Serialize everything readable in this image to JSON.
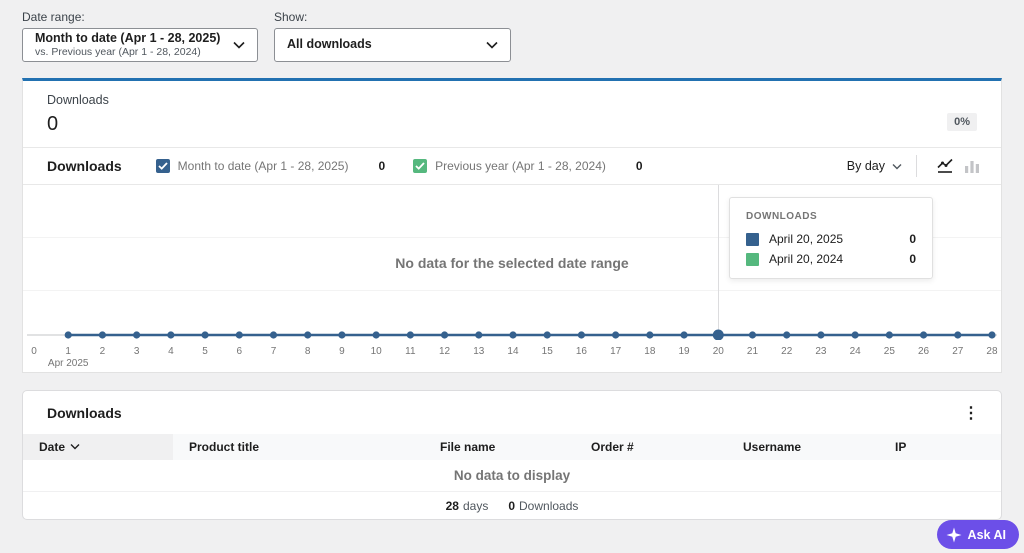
{
  "filters": {
    "date_range": {
      "label": "Date range:",
      "primary": "Month to date (Apr 1 - 28, 2025)",
      "secondary": "vs. Previous year (Apr 1 - 28, 2024)"
    },
    "show": {
      "label": "Show:",
      "value": "All downloads"
    }
  },
  "summary": {
    "label": "Downloads",
    "value": "0",
    "delta": "0%"
  },
  "chart": {
    "title": "Downloads",
    "interval": "By day",
    "empty_message": "No data for the selected date range",
    "month_label": "Apr 2025",
    "legend": [
      {
        "label": "Month to date (Apr 1 - 28, 2025)",
        "value": "0",
        "color": "#35618e",
        "checked": true
      },
      {
        "label": "Previous year (Apr 1 - 28, 2024)",
        "value": "0",
        "color": "#55b87e",
        "checked": true
      }
    ],
    "tooltip": {
      "header": "DOWNLOADS",
      "rows": [
        {
          "label": "April 20, 2025",
          "value": "0",
          "color": "#35618e"
        },
        {
          "label": "April 20, 2024",
          "value": "0",
          "color": "#55b87e"
        }
      ]
    }
  },
  "chart_data": {
    "type": "line",
    "title": "Downloads",
    "x_ticks": [
      0,
      1,
      2,
      3,
      4,
      5,
      6,
      7,
      8,
      9,
      10,
      11,
      12,
      13,
      14,
      15,
      16,
      17,
      18,
      19,
      20,
      21,
      22,
      23,
      24,
      25,
      26,
      27,
      28
    ],
    "x": [
      1,
      2,
      3,
      4,
      5,
      6,
      7,
      8,
      9,
      10,
      11,
      12,
      13,
      14,
      15,
      16,
      17,
      18,
      19,
      20,
      21,
      22,
      23,
      24,
      25,
      26,
      27,
      28
    ],
    "series": [
      {
        "name": "Month to date (Apr 1 - 28, 2025)",
        "color": "#35618e",
        "values": [
          0,
          0,
          0,
          0,
          0,
          0,
          0,
          0,
          0,
          0,
          0,
          0,
          0,
          0,
          0,
          0,
          0,
          0,
          0,
          0,
          0,
          0,
          0,
          0,
          0,
          0,
          0,
          0
        ]
      },
      {
        "name": "Previous year (Apr 1 - 28, 2024)",
        "color": "#55b87e",
        "values": [
          0,
          0,
          0,
          0,
          0,
          0,
          0,
          0,
          0,
          0,
          0,
          0,
          0,
          0,
          0,
          0,
          0,
          0,
          0,
          0,
          0,
          0,
          0,
          0,
          0,
          0,
          0,
          0
        ]
      }
    ],
    "hovered_x": 20,
    "ylim": [
      0,
      1
    ],
    "grid": true,
    "xlabel": "Apr 2025",
    "legend_position": "top"
  },
  "table": {
    "title": "Downloads",
    "columns": [
      {
        "label": "Date",
        "sorted": true
      },
      {
        "label": "Product title",
        "sorted": false
      },
      {
        "label": "File name",
        "sorted": false
      },
      {
        "label": "Order #",
        "sorted": false
      },
      {
        "label": "Username",
        "sorted": false
      },
      {
        "label": "IP",
        "sorted": false
      }
    ],
    "empty_message": "No data to display",
    "footer": {
      "days_value": "28",
      "days_label": "days",
      "downloads_value": "0",
      "downloads_label": "Downloads"
    }
  },
  "ask_ai": {
    "label": "Ask AI",
    "color": "#6C4FE8"
  },
  "colors": {
    "accent_blue": "#2271b1",
    "series_blue": "#35618e",
    "series_green": "#55b87e"
  }
}
